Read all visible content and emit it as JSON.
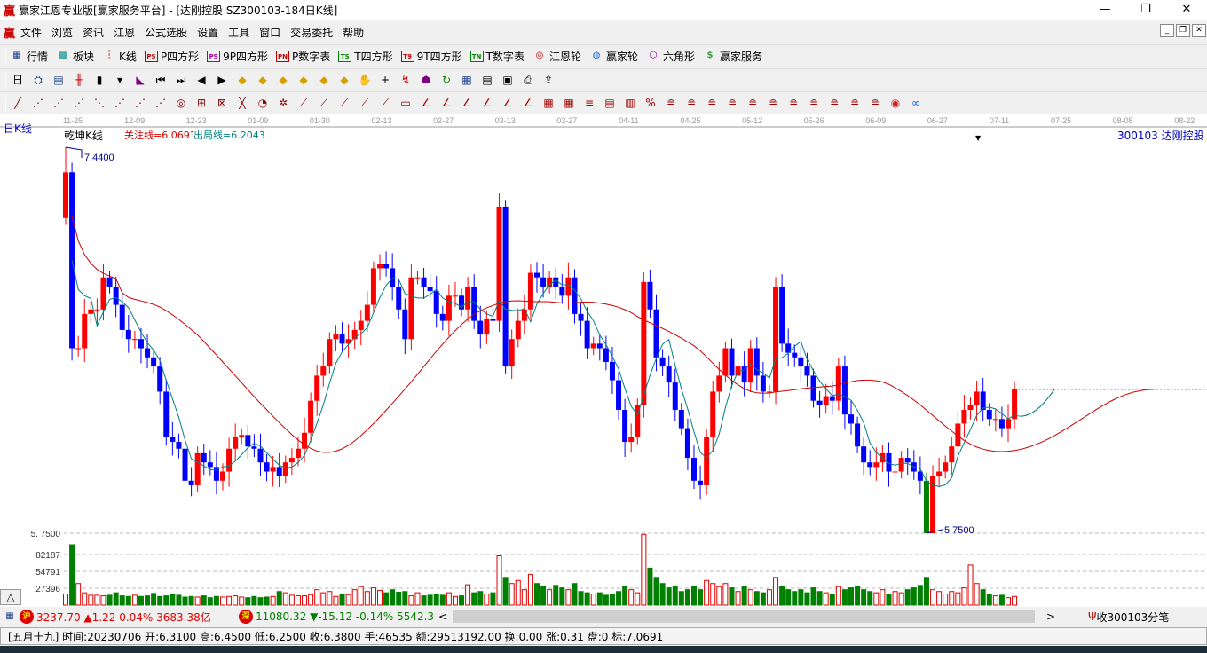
{
  "window": {
    "title": "赢家江恩专业版[赢家服务平台] - [达刚控股  SZ300103-184日K线]",
    "logo": "赢",
    "minimize": "—",
    "maximize": "❐",
    "close": "✕"
  },
  "menu": {
    "logo": "赢",
    "items": [
      "文件",
      "浏览",
      "资讯",
      "江恩",
      "公式选股",
      "设置",
      "工具",
      "窗口",
      "交易委托",
      "帮助"
    ],
    "mdi": [
      "_",
      "❐",
      "✕"
    ]
  },
  "toolbar1": [
    {
      "label": "行情",
      "icon": "grid-table-icon"
    },
    {
      "label": "板块",
      "icon": "blocks-icon"
    },
    {
      "label": "K线",
      "icon": "candlestick-icon"
    },
    {
      "label": "P四方形",
      "icon": "ps-icon",
      "badge": "PS",
      "color": "#c00000"
    },
    {
      "label": "9P四方形",
      "icon": "p9-icon",
      "badge": "P9",
      "color": "#a000a0"
    },
    {
      "label": "P数字表",
      "icon": "pn-icon",
      "badge": "PN",
      "color": "#c00000"
    },
    {
      "label": "T四方形",
      "icon": "ts-icon",
      "badge": "TS",
      "color": "#008000"
    },
    {
      "label": "9T四方形",
      "icon": "t9-icon",
      "badge": "T9",
      "color": "#c00000"
    },
    {
      "label": "T数字表",
      "icon": "tn-icon",
      "badge": "TN",
      "color": "#008000"
    },
    {
      "label": "江恩轮",
      "icon": "gann-wheel-icon"
    },
    {
      "label": "赢家轮",
      "icon": "winner-wheel-icon"
    },
    {
      "label": "六角形",
      "icon": "hexagon-icon"
    },
    {
      "label": "赢家服务",
      "icon": "dollar-icon"
    }
  ],
  "toolbar2_icons": [
    "period-dropdown-icon",
    "formula-icon",
    "document-icon",
    "candles-icon",
    "single-bar-icon",
    "indicator-dropdown-icon",
    "color-icon",
    "first-icon",
    "last-icon",
    "left-icon",
    "right-icon",
    "diamond-up-icon",
    "diamond-left-icon",
    "diamond-right-icon",
    "diamond-down-icon",
    "diamond-x-icon",
    "diamond-plus-icon",
    "hand-icon",
    "crosshair-icon",
    "trend-icon",
    "mask-icon",
    "refresh-icon",
    "calendar-icon",
    "calculator-icon",
    "save-icon",
    "camera-icon",
    "export-icon"
  ],
  "toolbar3_icons": [
    "line-tool-icon",
    "gann-fan-1-icon",
    "gann-fan-2-icon",
    "gann-fan-3-icon",
    "gann-fan-4-icon",
    "gann-fan-5-icon",
    "gann-fan-6-icon",
    "gann-fan-7-icon",
    "circle-grid-icon",
    "gann-box-icon",
    "gann-grid-icon",
    "gann-line-icon",
    "cycle-icon",
    "wheel-icon",
    "gann-ray-1-icon",
    "gann-ray-2-icon",
    "gann-ray-3-icon",
    "gann-ray-4-icon",
    "gann-ray-5-icon",
    "box-select-icon",
    "angle-1-icon",
    "angle-2-icon",
    "angle-3-icon",
    "angle-4-icon",
    "angle-5-icon",
    "angle-6-icon",
    "grid-icon",
    "grid-2-icon",
    "parallel-icon",
    "table-icon",
    "fibonacci-icon",
    "percent-icon",
    "level-1-icon",
    "level-2-icon",
    "level-3-icon",
    "level-4-icon",
    "level-5-icon",
    "level-6-icon",
    "level-7-icon",
    "level-8-icon",
    "level-9-icon",
    "level-10-icon",
    "level-11-icon",
    "globe-icon",
    "infinity-icon"
  ],
  "chart_header": {
    "period": "日K线",
    "indicator": "乾坤K线",
    "focus_line": "关注线=6.0691",
    "exit_line": "出局线=6.2043",
    "stock": "300103  达刚控股"
  },
  "chart_data": {
    "type": "candlestick",
    "title": "达刚控股 SZ300103 日K线",
    "x_ticks": [
      "11-25",
      "12-09",
      "12-23",
      "01-09",
      "01-30",
      "02-13",
      "02-27",
      "03-13",
      "03-27",
      "04-11",
      "04-25",
      "05-12",
      "05-26",
      "06-09",
      "06-27",
      "07-11",
      "07-25",
      "08-08",
      "08-22"
    ],
    "ylim": [
      5.75,
      7.44
    ],
    "max_label": "7.4400",
    "min_label": "5.7500",
    "axis_min_label": "5. 7500",
    "closes": [
      7.33,
      6.56,
      6.56,
      6.71,
      6.73,
      6.73,
      6.87,
      6.83,
      6.75,
      6.64,
      6.6,
      6.6,
      6.56,
      6.52,
      6.48,
      6.37,
      6.17,
      6.15,
      6.12,
      5.98,
      5.96,
      6.1,
      6.06,
      6.04,
      5.98,
      6.02,
      6.12,
      6.17,
      6.18,
      6.13,
      6.12,
      6.06,
      6.02,
      6.04,
      6.0,
      6.06,
      6.08,
      6.12,
      6.19,
      6.33,
      6.44,
      6.48,
      6.6,
      6.62,
      6.58,
      6.6,
      6.64,
      6.68,
      6.75,
      6.91,
      6.93,
      6.91,
      6.83,
      6.73,
      6.6,
      6.87,
      6.87,
      6.83,
      6.81,
      6.71,
      6.68,
      6.79,
      6.79,
      6.73,
      6.83,
      6.68,
      6.62,
      6.69,
      6.68,
      7.18,
      6.48,
      6.6,
      6.68,
      6.73,
      6.89,
      6.87,
      6.83,
      6.87,
      6.83,
      6.79,
      6.87,
      6.71,
      6.68,
      6.56,
      6.58,
      6.56,
      6.5,
      6.42,
      6.29,
      6.15,
      6.17,
      6.31,
      6.85,
      6.73,
      6.52,
      6.48,
      6.41,
      6.29,
      6.21,
      6.08,
      5.98,
      5.96,
      6.17,
      6.37,
      6.44,
      6.56,
      6.44,
      6.48,
      6.41,
      6.56,
      6.44,
      6.37,
      6.37,
      6.83,
      6.58,
      6.54,
      6.52,
      6.48,
      6.44,
      6.33,
      6.31,
      6.35,
      6.33,
      6.48,
      6.27,
      6.23,
      6.13,
      6.06,
      6.04,
      6.06,
      6.1,
      6.02,
      6.02,
      6.08,
      6.06,
      6.02,
      5.98,
      5.75,
      6.0,
      6.02,
      6.06,
      6.13,
      6.23,
      6.29,
      6.31,
      6.37,
      6.29,
      6.25,
      6.25,
      6.21,
      6.25,
      6.38
    ],
    "volume_ticks": [
      "82187",
      "54791",
      "27396"
    ],
    "volume_ticks_values": [
      82187,
      54791,
      27396
    ],
    "volumes": [
      18000,
      98000,
      35000,
      20000,
      16000,
      16000,
      15000,
      16000,
      20000,
      15000,
      14000,
      16000,
      14000,
      15000,
      19000,
      14000,
      15000,
      17000,
      16000,
      13000,
      14000,
      13000,
      15000,
      12000,
      14000,
      13000,
      14000,
      15000,
      13000,
      12000,
      14000,
      12000,
      13000,
      14000,
      22000,
      20000,
      16000,
      15000,
      15000,
      17000,
      25000,
      20000,
      22000,
      14000,
      18000,
      17000,
      25000,
      30000,
      22000,
      28000,
      24000,
      20000,
      25000,
      21000,
      22000,
      15000,
      20000,
      15000,
      16000,
      18000,
      16000,
      20000,
      14000,
      15000,
      33000,
      20000,
      22000,
      18000,
      20000,
      80000,
      45000,
      35000,
      40000,
      25000,
      50000,
      35000,
      30000,
      25000,
      32000,
      28000,
      25000,
      35000,
      22000,
      20000,
      18000,
      20000,
      16000,
      18000,
      22000,
      30000,
      25000,
      20000,
      115000,
      60000,
      45000,
      35000,
      28000,
      30000,
      22000,
      25000,
      30000,
      25000,
      40000,
      35000,
      30000,
      35000,
      28000,
      22000,
      30000,
      25000,
      22000,
      20000,
      25000,
      45000,
      30000,
      25000,
      22000,
      25000,
      20000,
      28000,
      22000,
      20000,
      18000,
      30000,
      25000,
      28000,
      30000,
      25000,
      22000,
      20000,
      25000,
      18000,
      22000,
      20000,
      25000,
      28000,
      32000,
      45000,
      25000,
      22000,
      18000,
      22000,
      20000,
      28000,
      65000,
      35000,
      25000,
      18000,
      15000,
      16000,
      12000,
      14000
    ],
    "colors": {
      "up": "#ff0000",
      "down": "#0000ff",
      "ma_fast": "#008080",
      "ma_slow": "#cc0000",
      "vol_down": "#008000"
    }
  },
  "index_bar": {
    "sh_badge": "沪",
    "sh": "3237.70 ▲1.22 0.04% 3683.38亿",
    "sz_badge": "深",
    "sz": "11080.32 ▼-15.12 -0.14% 5542.38",
    "scroll_left": "<",
    "scroll_right": ">",
    "tick_label": "收300103分笔"
  },
  "status": "[五月十九] 时间:20230706 开:6.3100 高:6.4500 低:6.2500 收:6.3800 手:46535 额:29513192.00 换:0.00 涨:0.31 盘:0 标:7.0691",
  "collapse_button": "△"
}
